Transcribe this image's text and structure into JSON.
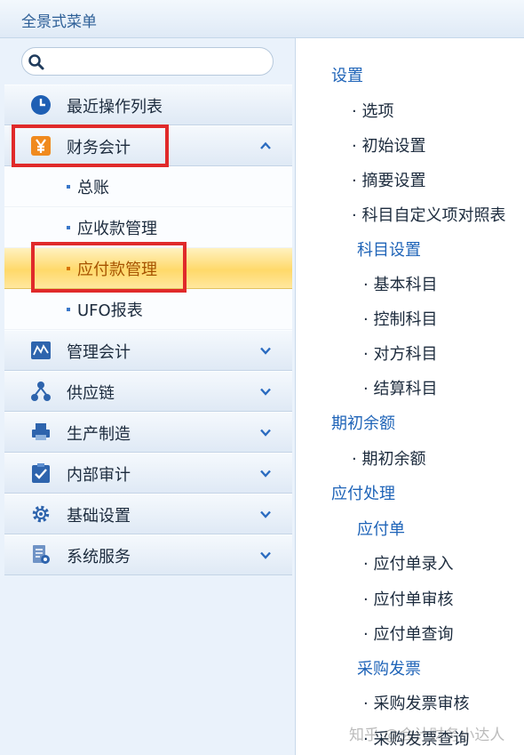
{
  "window": {
    "title": "全景式菜单"
  },
  "search": {
    "placeholder": "",
    "value": ""
  },
  "menu": {
    "recent": "最近操作列表",
    "finance": "财务会计",
    "finance_items": [
      "总账",
      "应收款管理",
      "应付款管理",
      "UFO报表"
    ],
    "active_item": "应付款管理",
    "groups": [
      "管理会计",
      "供应链",
      "生产制造",
      "内部审计",
      "基础设置",
      "系统服务"
    ]
  },
  "detail": {
    "settings": "设置",
    "settings_items": [
      "选项",
      "初始设置",
      "摘要设置",
      "科目自定义项对照表"
    ],
    "subject_settings": "科目设置",
    "subject_items": [
      "基本科目",
      "控制科目",
      "对方科目",
      "结算科目"
    ],
    "opening": "期初余额",
    "opening_items": [
      "期初余额"
    ],
    "payable": "应付处理",
    "payable_bill": "应付单",
    "payable_bill_items": [
      "应付单录入",
      "应付单审核",
      "应付单查询"
    ],
    "purchase_invoice": "采购发票",
    "purchase_invoice_items": [
      "采购发票审核",
      "采购发票查询"
    ]
  },
  "watermark": "知乎 @会计财务小达人",
  "colors": {
    "accent": "#1f64b8",
    "highlight": "#e02a2a",
    "active_bg": "#ffd96a"
  }
}
